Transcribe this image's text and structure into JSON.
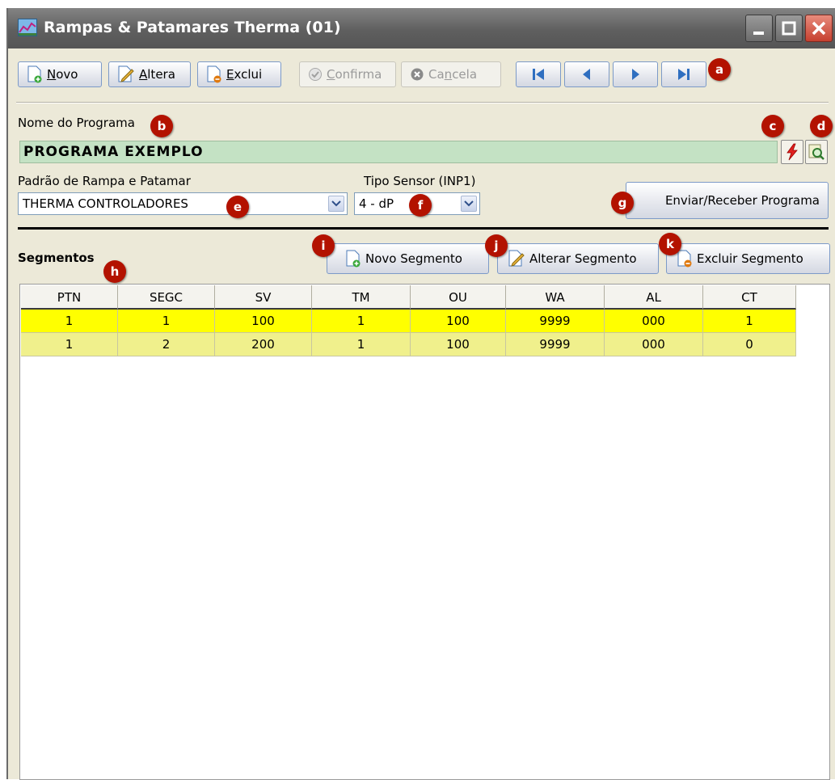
{
  "window": {
    "title": "Rampas & Patamares Therma (01)"
  },
  "toolbar": {
    "novo_prefix": "",
    "novo_hotkey": "N",
    "novo_rest": "ovo",
    "altera_hotkey": "A",
    "altera_rest": "ltera",
    "exclui_hotkey": "E",
    "exclui_rest": "xclui",
    "confirma_hotkey": "C",
    "confirma_rest": "onfirma",
    "cancela_prefix": "Ca",
    "cancela_hotkey": "n",
    "cancela_rest": "cela"
  },
  "program": {
    "name_label": "Nome do Programa",
    "name_value": "PROGRAMA EXEMPLO",
    "pattern_label": "Padrão de Rampa e Patamar",
    "pattern_value": "THERMA CONTROLADORES",
    "sensor_label": "Tipo Sensor (INP1)",
    "sensor_value": "4 - dP",
    "send_receive_label": "Enviar/Receber Programa"
  },
  "segments": {
    "title": "Segmentos",
    "new_label": "Novo Segmento",
    "edit_label": "Alterar Segmento",
    "delete_label": "Excluir Segmento",
    "columns": [
      "PTN",
      "SEGC",
      "SV",
      "TM",
      "OU",
      "WA",
      "AL",
      "CT"
    ],
    "rows": [
      [
        "1",
        "1",
        "100",
        "1",
        "100",
        "9999",
        "000",
        "1"
      ],
      [
        "1",
        "2",
        "200",
        "1",
        "100",
        "9999",
        "000",
        "0"
      ]
    ]
  },
  "badges": [
    "a",
    "b",
    "c",
    "d",
    "e",
    "f",
    "g",
    "h",
    "i",
    "j",
    "k"
  ],
  "colors": {
    "selected_row": "#ffff00",
    "other_row": "#f0f08c",
    "name_field": "#c4e2c4",
    "badge": "#b31200"
  }
}
